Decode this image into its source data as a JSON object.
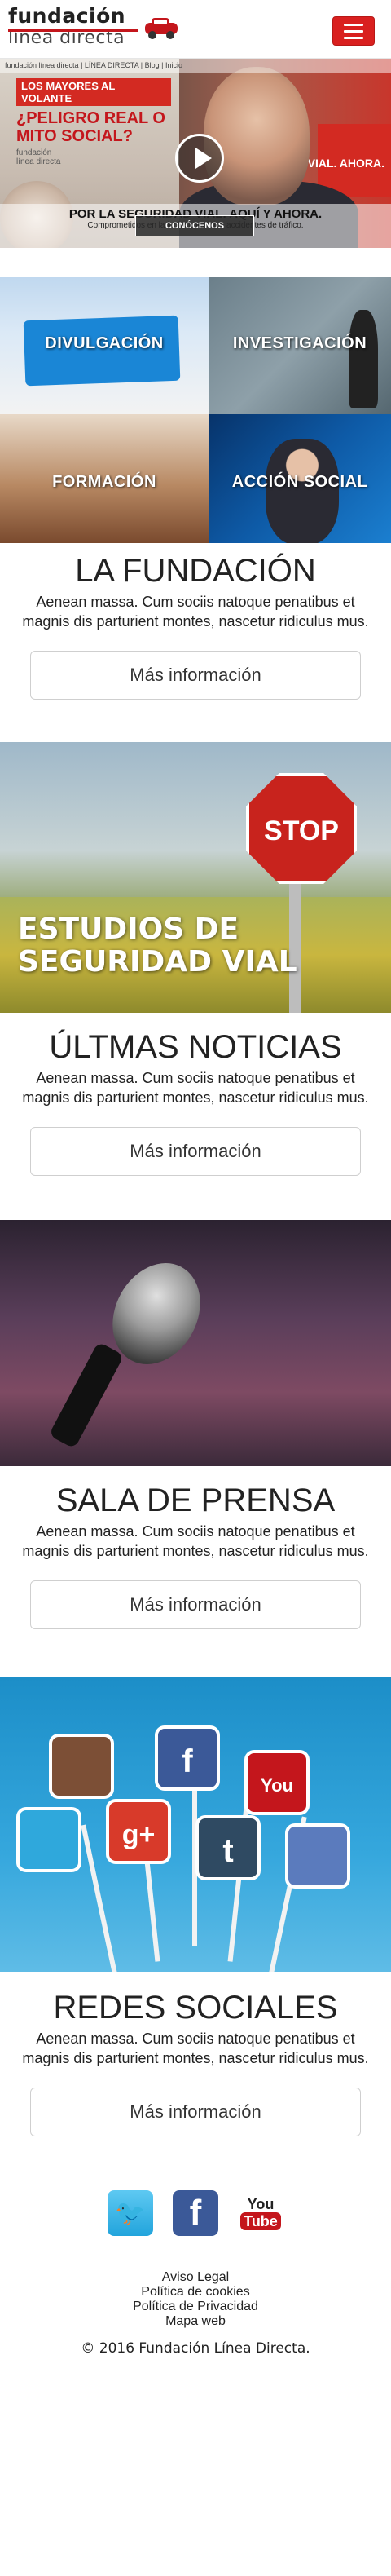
{
  "header": {
    "logo_line1": "fundación",
    "logo_line2": "línea directa"
  },
  "hero": {
    "topline": "fundación línea directa | LÍNEA DIRECTA | Blog | Inicio",
    "sign_tag": "LOS MAYORES AL VOLANTE",
    "sign_title": "¿PELIGRO REAL O MITO SOCIAL?",
    "sign_brand1": "fundación",
    "sign_brand2": "línea directa",
    "red_text": "VIAL. AHORA.",
    "title": "POR LA SEGURIDAD VIAL. AQUÍ Y AHORA.",
    "subtitle": "Comprometidos en la lucha contra los accidentes de tráfico.",
    "cta": "CONÓCENOS"
  },
  "cards": [
    {
      "label": "DIVULGACIÓN"
    },
    {
      "label": "INVESTIGACIÓN"
    },
    {
      "label": "FORMACIÓN"
    },
    {
      "label": "ACCIÓN SOCIAL"
    }
  ],
  "sections": {
    "fundacion": {
      "title": "LA FUNDACIÓN",
      "text": "Aenean massa. Cum sociis natoque penatibus et magnis dis parturient montes, nascetur ridiculus mus.",
      "button": "Más información"
    },
    "estudios": {
      "image_caption_l1": "ESTUDIOS DE",
      "image_caption_l2": "SEGURIDAD VIAL",
      "stop": "STOP"
    },
    "noticias": {
      "title": "ÚLTMAS NOTICIAS",
      "text": "Aenean massa. Cum sociis natoque penatibus et magnis dis parturient montes, nascetur ridiculus mus.",
      "button": "Más información"
    },
    "prensa": {
      "title": "SALA DE PRENSA",
      "text": "Aenean massa. Cum sociis natoque penatibus et magnis dis parturient montes, nascetur ridiculus mus.",
      "button": "Más información"
    },
    "redes": {
      "title": "REDES SOCIALES",
      "text": "Aenean massa. Cum sociis natoque penatibus et magnis dis parturient montes, nascetur ridiculus mus.",
      "button": "Más información"
    }
  },
  "footer": {
    "icons": {
      "twitter_glyph": "🐦",
      "facebook_glyph": "f",
      "youtube_you": "You",
      "youtube_tube": "Tube"
    },
    "links": [
      "Aviso Legal",
      "Política de cookies",
      "Política de Privacidad",
      "Mapa web"
    ],
    "copyright": "© 2016 Fundación Línea Directa."
  },
  "colors": {
    "brand_red": "#d9201f",
    "text_dark": "#222222"
  }
}
